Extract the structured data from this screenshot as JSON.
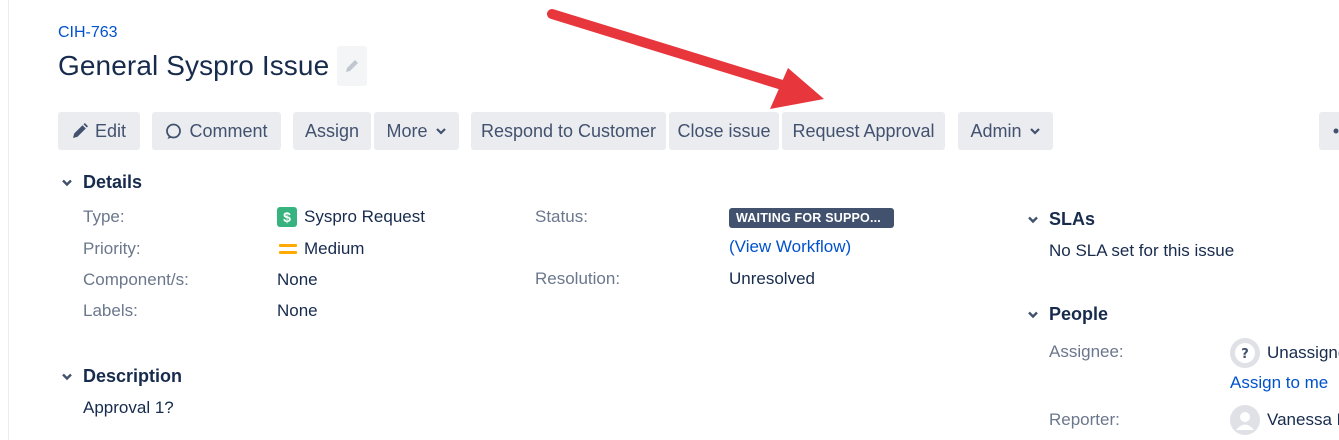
{
  "issue": {
    "key": "CIH-763",
    "title": "General Syspro Issue"
  },
  "toolbar": {
    "edit": "Edit",
    "comment": "Comment",
    "assign": "Assign",
    "more": "More",
    "respond": "Respond to Customer",
    "close": "Close issue",
    "request_approval": "Request Approval",
    "admin": "Admin"
  },
  "details": {
    "heading": "Details",
    "type_label": "Type:",
    "type_value": "Syspro Request",
    "priority_label": "Priority:",
    "priority_value": "Medium",
    "components_label": "Component/s:",
    "components_value": "None",
    "labels_label": "Labels:",
    "labels_value": "None",
    "status_label": "Status:",
    "status_value": "WAITING FOR SUPPO...",
    "view_workflow": "(View Workflow)",
    "resolution_label": "Resolution:",
    "resolution_value": "Unresolved"
  },
  "description": {
    "heading": "Description",
    "text": "Approval 1?"
  },
  "slas": {
    "heading": "SLAs",
    "text": "No SLA set for this issue"
  },
  "people": {
    "heading": "People",
    "assignee_label": "Assignee:",
    "assignee_value": "Unassigne",
    "assign_to_me": "Assign to me",
    "reporter_label": "Reporter:",
    "reporter_value": "Vanessa B"
  },
  "colors": {
    "link": "#0052cc",
    "annotation_arrow": "#e8363d",
    "status_lozenge": "#42526e",
    "type_icon": "#36b37e",
    "priority_medium": "#ffab00"
  }
}
